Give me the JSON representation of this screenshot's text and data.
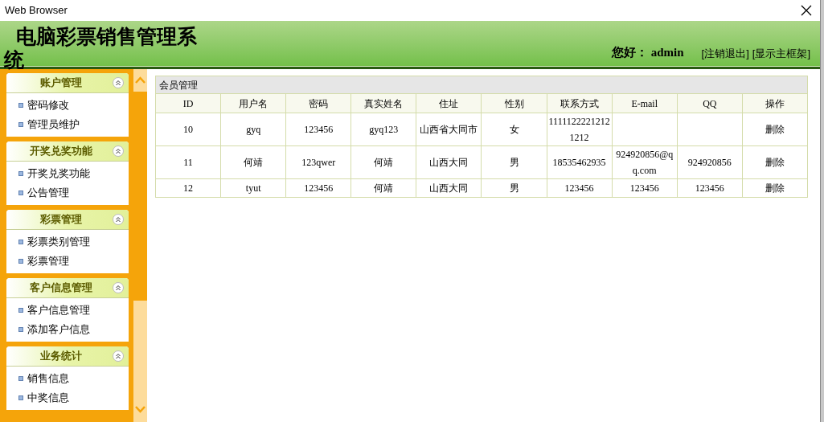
{
  "window": {
    "title": "Web Browser"
  },
  "header": {
    "title": "电脑彩票销售管理系统",
    "greeting": "您好：",
    "user": "admin",
    "links": [
      "[注销退出]",
      "[显示主框架]"
    ]
  },
  "sidebar": {
    "groups": [
      {
        "title": "账户管理",
        "expanded": true,
        "items": [
          "密码修改",
          "管理员维护"
        ]
      },
      {
        "title": "开奖兑奖功能",
        "expanded": true,
        "items": [
          "开奖兑奖功能",
          "公告管理"
        ]
      },
      {
        "title": "彩票管理",
        "expanded": true,
        "items": [
          "彩票类别管理",
          "彩票管理"
        ]
      },
      {
        "title": "客户信息管理",
        "expanded": true,
        "items": [
          "客户信息管理",
          "添加客户信息"
        ]
      },
      {
        "title": "业务统计",
        "expanded": true,
        "items": [
          "销售信息",
          "中奖信息"
        ]
      }
    ]
  },
  "table": {
    "caption": "会员管理",
    "columns": [
      "ID",
      "用户名",
      "密码",
      "真实姓名",
      "住址",
      "性别",
      "联系方式",
      "E-mail",
      "QQ",
      "操作"
    ],
    "rows": [
      [
        "10",
        "gyq",
        "123456",
        "gyq123",
        "山西省大同市",
        "女",
        "1111122221212 1212",
        "",
        "",
        "删除"
      ],
      [
        "11",
        "何靖",
        "123qwer",
        "何靖",
        "山西大同",
        "男",
        "18535462935",
        "924920856@q q.com",
        "924920856",
        "删除"
      ],
      [
        "12",
        "tyut",
        "123456",
        "何靖",
        "山西大同",
        "男",
        "123456",
        "123456",
        "123456",
        "删除"
      ]
    ]
  }
}
